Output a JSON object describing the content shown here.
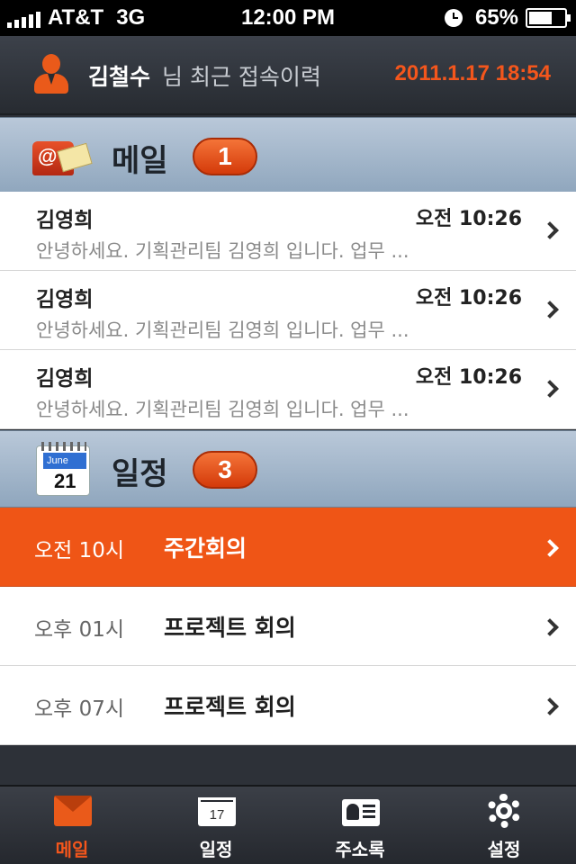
{
  "status_bar": {
    "carrier": "AT&T",
    "network": "3G",
    "time": "12:00 PM",
    "battery": "65%",
    "battery_level": 0.65
  },
  "header": {
    "user_name": "김철수",
    "subtitle": "님 최근 접속이력",
    "datetime": "2011.1.17 18:54"
  },
  "mail_section": {
    "title": "메일",
    "count": "1",
    "items": [
      {
        "sender": "김영희",
        "time": "오전 10:26",
        "preview": "안녕하세요. 기획관리팀 김영희 입니다. 업무 ..."
      },
      {
        "sender": "김영희",
        "time": "오전 10:26",
        "preview": "안녕하세요. 기획관리팀 김영희 입니다. 업무 ..."
      },
      {
        "sender": "김영희",
        "time": "오전 10:26",
        "preview": "안녕하세요. 기획관리팀 김영희 입니다. 업무 ..."
      }
    ]
  },
  "schedule_section": {
    "title": "일정",
    "count": "3",
    "icon_month": "June",
    "icon_day": "21",
    "items": [
      {
        "time": "오전 10시",
        "title": "주간회의",
        "selected": true
      },
      {
        "time": "오후 01시",
        "title": "프로젝트 회의",
        "selected": false
      },
      {
        "time": "오후 07시",
        "title": "프로젝트 회의",
        "selected": false
      }
    ]
  },
  "tab_bar": {
    "tabs": [
      {
        "label": "메일",
        "icon": "mail-icon",
        "active": true
      },
      {
        "label": "일정",
        "icon": "calendar-icon",
        "active": false,
        "icon_text": "17"
      },
      {
        "label": "주소록",
        "icon": "address-book-icon",
        "active": false
      },
      {
        "label": "설정",
        "icon": "gear-icon",
        "active": false
      }
    ]
  },
  "colors": {
    "accent": "#ef5516",
    "header_bg": "#2d3138",
    "section_bg": "#a3b6c9"
  }
}
